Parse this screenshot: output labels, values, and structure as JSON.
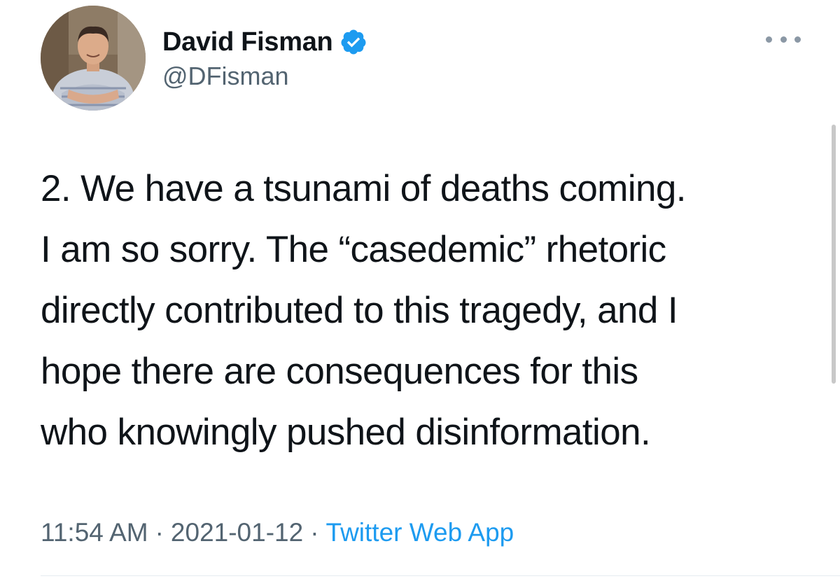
{
  "author": {
    "display_name": "David Fisman",
    "handle": "@DFisman",
    "verified": true,
    "verified_icon": "verified-badge-icon",
    "verified_color": "#1d9bf0"
  },
  "more_menu_icon": "ellipsis-icon",
  "tweet": {
    "text": "2. We have a tsunami of deaths coming.\nI am so sorry.  The “casedemic” rhetoric\ndirectly contributed to this tragedy, and I\nhope there are consequences for this\nwho knowingly pushed disinformation."
  },
  "meta": {
    "time": "11:54 AM",
    "separator": "·",
    "date": "2021-01-12",
    "source": "Twitter Web App",
    "source_color": "#1d9bf0"
  }
}
